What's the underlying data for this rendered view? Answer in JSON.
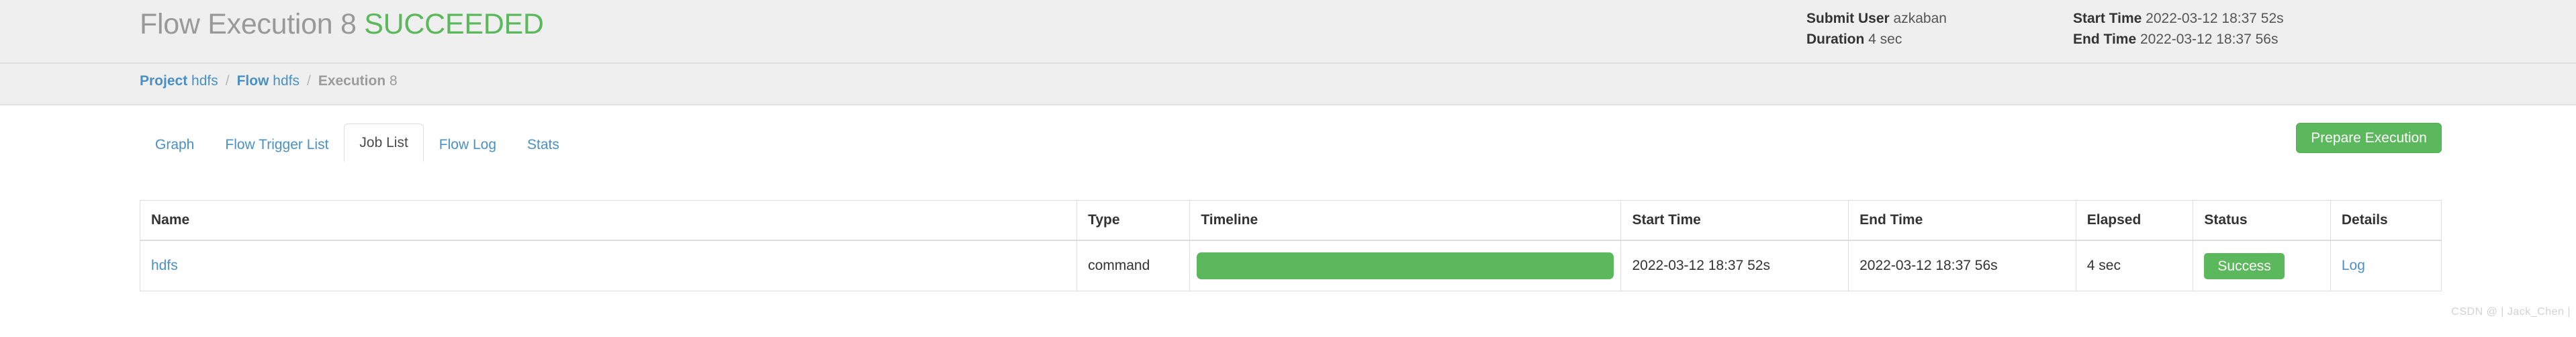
{
  "header": {
    "title_prefix": "Flow Execution 8",
    "status_word": "SUCCEEDED",
    "meta": {
      "submit_user_label": "Submit User",
      "submit_user_value": "azkaban",
      "duration_label": "Duration",
      "duration_value": "4 sec",
      "start_time_label": "Start Time",
      "start_time_value": "2022-03-12 18:37 52s",
      "end_time_label": "End Time",
      "end_time_value": "2022-03-12 18:37 56s"
    }
  },
  "breadcrumb": {
    "project_label": "Project",
    "project_value": "hdfs",
    "flow_label": "Flow",
    "flow_value": "hdfs",
    "execution_label": "Execution",
    "execution_value": "8",
    "separator": "/"
  },
  "tabs": [
    {
      "label": "Graph",
      "active": false
    },
    {
      "label": "Flow Trigger List",
      "active": false
    },
    {
      "label": "Job List",
      "active": true
    },
    {
      "label": "Flow Log",
      "active": false
    },
    {
      "label": "Stats",
      "active": false
    }
  ],
  "actions": {
    "prepare_execution_label": "Prepare Execution"
  },
  "table": {
    "columns": [
      "Name",
      "Type",
      "Timeline",
      "Start Time",
      "End Time",
      "Elapsed",
      "Status",
      "Details"
    ],
    "rows": [
      {
        "name": "hdfs",
        "type": "command",
        "timeline_percent": 100,
        "start_time": "2022-03-12 18:37 52s",
        "end_time": "2022-03-12 18:37 56s",
        "elapsed": "4 sec",
        "status": "Success",
        "details": "Log"
      }
    ]
  },
  "watermark": {
    "text": "CSDN @ | Jack_Chen |"
  },
  "colors": {
    "success_green": "#5cb85c",
    "link_blue": "#4a90c4",
    "header_bg": "#efefef",
    "title_gray": "#999999",
    "border_gray": "#dddddd"
  }
}
